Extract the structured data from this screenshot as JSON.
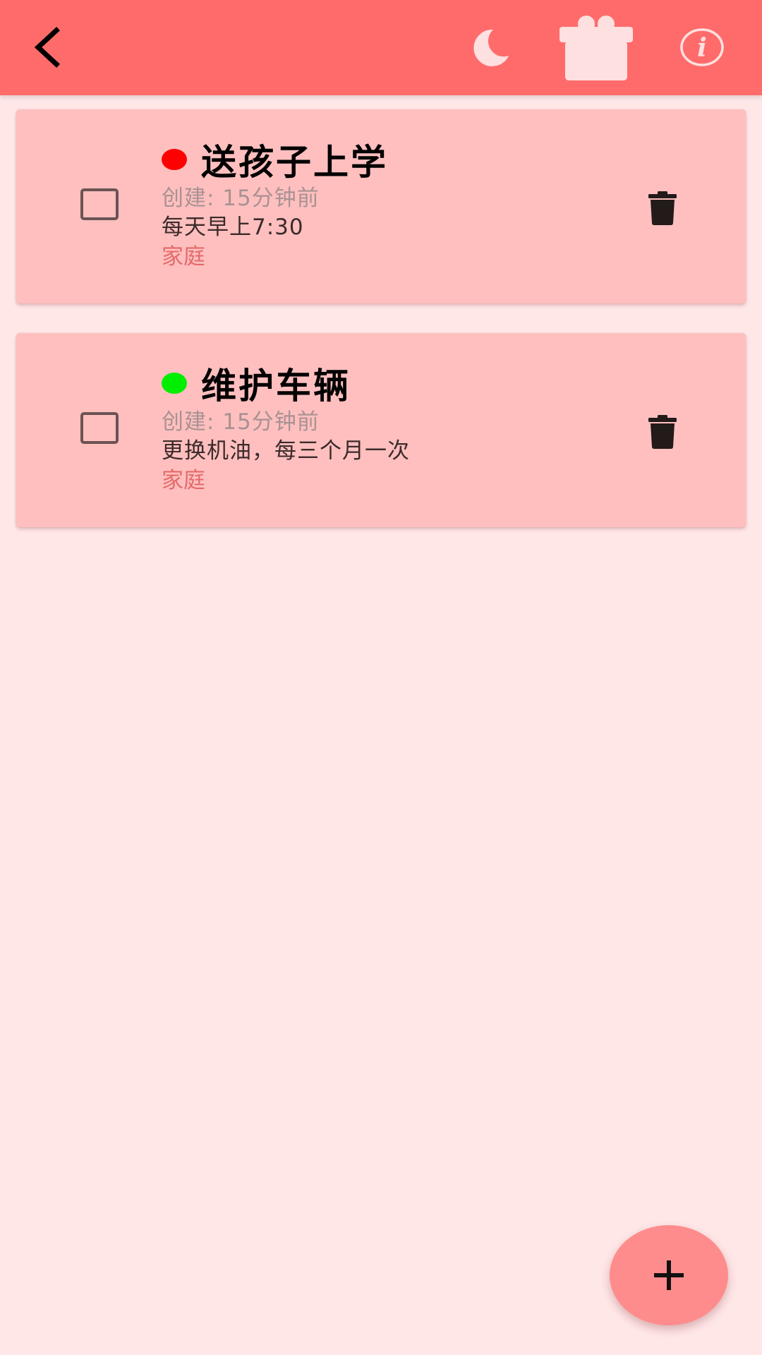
{
  "app_bar": {
    "background": "#ff6b6b",
    "back_icon": "chevron-left-icon",
    "actions": [
      {
        "name": "night-mode-button",
        "icon": "moon-icon"
      },
      {
        "name": "gift-button",
        "icon": "gift-icon"
      },
      {
        "name": "info-button",
        "icon": "info-icon"
      }
    ]
  },
  "todos": [
    {
      "title": "送孩子上学",
      "priority_color": "#ff0000",
      "created": "创建: 15分钟前",
      "description": "每天早上7:30",
      "category": "家庭",
      "checked": false
    },
    {
      "title": "维护车辆",
      "priority_color": "#00ee00",
      "created": "创建: 15分钟前",
      "description": "更换机油，每三个月一次",
      "category": "家庭",
      "checked": false
    }
  ],
  "fab": {
    "icon": "plus-icon"
  },
  "colors": {
    "page_background": "#ffe6e7",
    "card_background": "#ffbfbf",
    "fab_background": "#ff8c8c",
    "category_text": "#e46a6a"
  }
}
